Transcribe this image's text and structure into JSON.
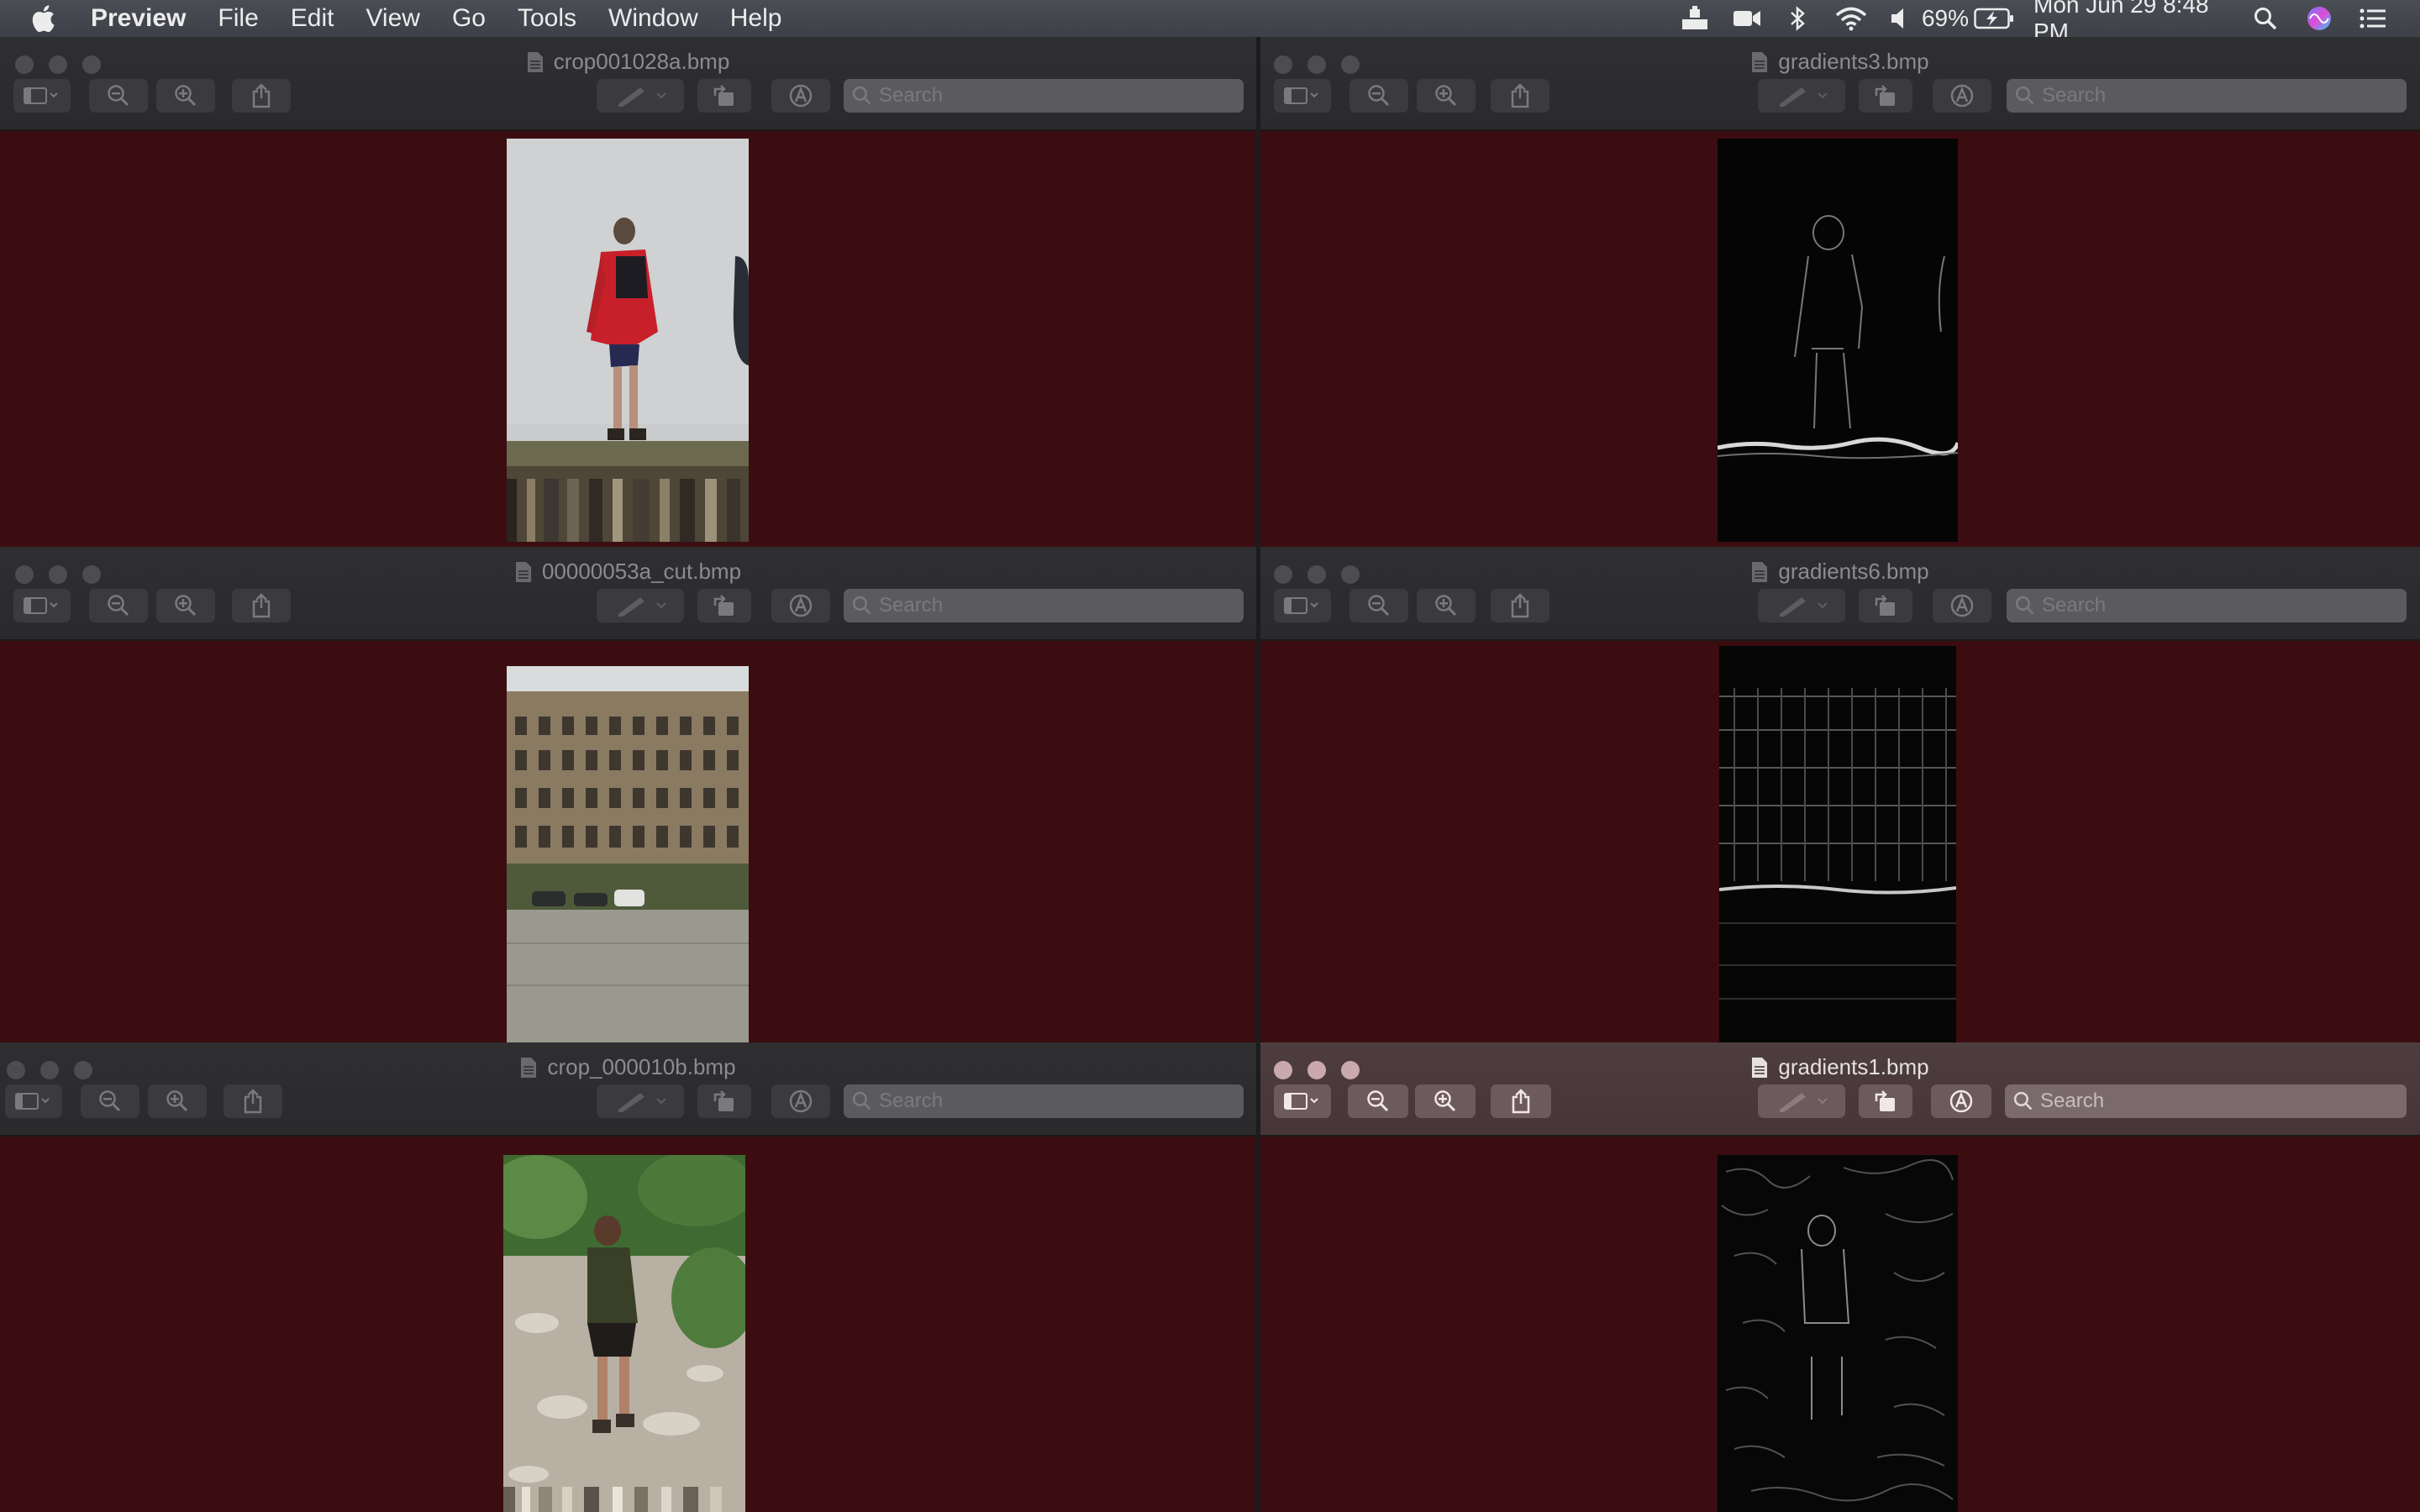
{
  "menubar": {
    "app_name": "Preview",
    "items": [
      "File",
      "Edit",
      "View",
      "Go",
      "Tools",
      "Window",
      "Help"
    ],
    "battery": "69%",
    "datetime": "Mon Jun 29  8:48 PM"
  },
  "windows": [
    {
      "title": "crop001028a.bmp",
      "search_placeholder": "Search"
    },
    {
      "title": "gradients3.bmp",
      "search_placeholder": "Search"
    },
    {
      "title": "00000053a_cut.bmp",
      "search_placeholder": "Search"
    },
    {
      "title": "gradients6.bmp",
      "search_placeholder": "Search"
    },
    {
      "title": "crop_000010b.bmp",
      "search_placeholder": "Search"
    },
    {
      "title": "gradients1.bmp",
      "search_placeholder": "Search"
    }
  ],
  "icons": {
    "apple": "apple-icon",
    "status": [
      "user-switch-icon",
      "camera-icon",
      "bluetooth-icon",
      "wifi-icon",
      "volume-icon",
      "battery-icon",
      "search-icon",
      "siri-icon",
      "list-icon"
    ],
    "toolbar": [
      "sidebar-icon",
      "zoom-out-icon",
      "zoom-in-icon",
      "share-icon",
      "markup-pen-icon",
      "rotate-icon",
      "annotate-icon",
      "search-icon"
    ]
  },
  "colors": {
    "background": "#3b0d11",
    "titlebar": "#2f2f31",
    "active_titlebar": "#4e3d3f"
  }
}
